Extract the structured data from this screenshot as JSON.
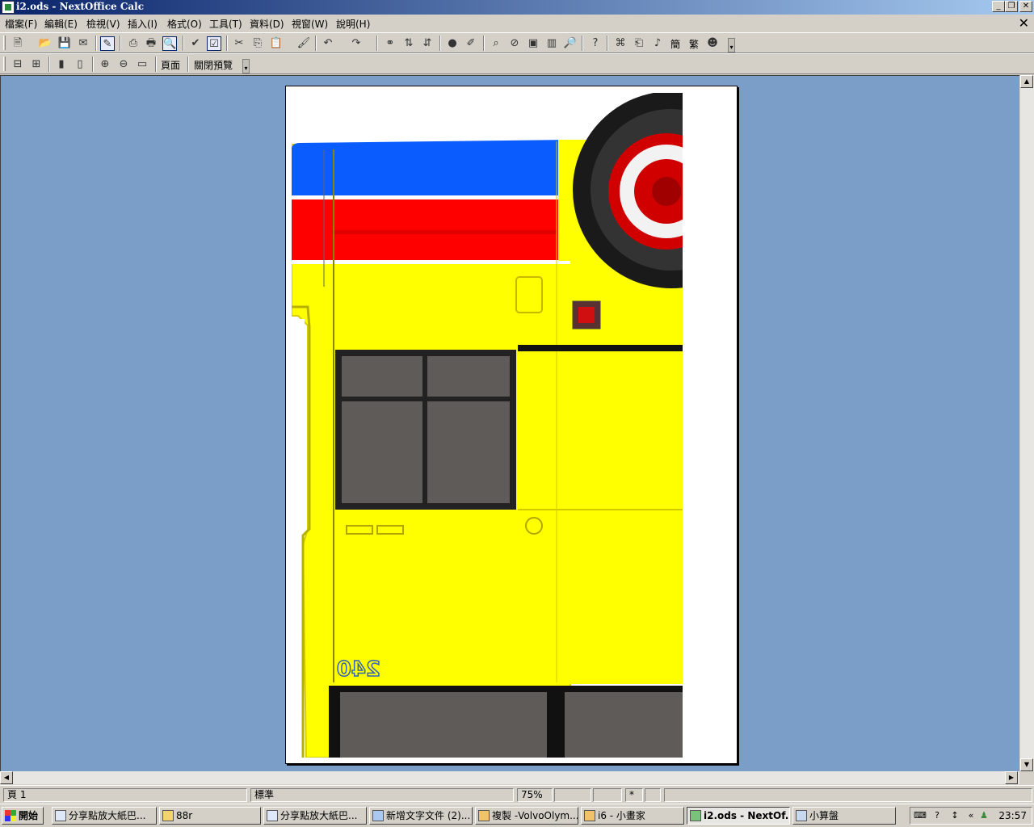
{
  "window": {
    "title": "i2.ods - NextOffice Calc",
    "controls": [
      "_",
      "❐",
      "✕"
    ]
  },
  "menu": [
    "檔案(F)",
    "編輯(E)",
    "檢視(V)",
    "插入(I)",
    "格式(O)",
    "工具(T)",
    "資料(D)",
    "視窗(W)",
    "說明(H)"
  ],
  "menu_close": "✕",
  "toolbar1": {
    "icons": [
      "new-icon",
      "open-icon",
      "save-icon",
      "email-icon",
      "edit-file-icon",
      "export-pdf-icon",
      "print-icon",
      "page-preview-icon",
      "spellcheck-icon",
      "autospell-icon",
      "cut-icon",
      "copy-icon",
      "paste-icon",
      "format-paintbrush-icon",
      "undo-icon",
      "redo-icon",
      "hyperlink-icon",
      "sort-ascending-icon",
      "sort-descending-icon",
      "chart-icon",
      "draw-icon",
      "find-icon",
      "navigator-icon",
      "gallery-icon",
      "datasource-icon",
      "zoom-icon",
      "help-icon"
    ],
    "convert_simplified": "簡",
    "convert_traditional": "繁"
  },
  "toolbar2": {
    "page_button": "頁面",
    "close_preview_button": "關閉預覽"
  },
  "preview": {
    "page_number_mark": "240",
    "colors": {
      "background": "#7b9ec9",
      "blue_band": "#0a5cff",
      "red_band": "#ff0000",
      "body": "#ffff00",
      "window": "#5f5b59"
    }
  },
  "status": {
    "page": "頁 1",
    "style": "標準",
    "zoom": "75%",
    "modified": "*"
  },
  "taskbar": {
    "start": "開始",
    "tasks": [
      "分享點放大紙巴...",
      "88r",
      "分享點放大紙巴...",
      "新增文字文件 (2)...",
      "複製 -VolvoOlym...",
      "i6 - 小畫家",
      "i2.ods - NextOf...",
      "小算盤"
    ],
    "active_index": 6,
    "tray_expand": "«",
    "clock": "23:57"
  }
}
